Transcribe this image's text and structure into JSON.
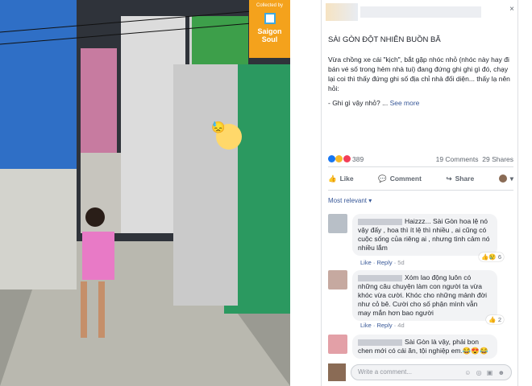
{
  "photo": {
    "badge_top": "Collected by",
    "badge_brand_1": "Saigon",
    "badge_brand_2": "Soul",
    "sweat_emoji": "😓"
  },
  "post": {
    "close_glyph": "×",
    "title": "SÀI GÒN ĐỘT NHIÊN BUỒN BÃ",
    "body_1": "Vừa chồng xe cái \"kịch\", bắt gặp nhóc nhỏ (nhóc này hay đi bán vé số trong hẻm nhà tui) đang đứng ghi ghi gì đó, chạy lại coi thì thấy đứng ghi số địa chỉ nhà đối diện... thấy lạ nên hỏi:",
    "body_2": "- Ghi gì vậy nhỏ? ...",
    "see_more": "See more",
    "reaction_count": "389",
    "comments_count": "19 Comments",
    "shares_count": "29 Shares",
    "actions": {
      "like": "Like",
      "comment": "Comment",
      "share": "Share"
    },
    "most_relevant": "Most relevant ▾",
    "reaction_colors": [
      "#1877f2",
      "#f7b928",
      "#f33e58"
    ]
  },
  "comments": [
    {
      "text": "Haizzz... Sài Gòn hoa lệ nó vậy đấy , hoa thì ít lệ thì nhiều , ai cũng có cuộc sống của riêng ai , nhưng tình cảm nó nhiều lắm",
      "like": "Like",
      "reply": "Reply",
      "time": "5d",
      "reactions": "👍😢 6"
    },
    {
      "text": "Xóm lao động luôn có những câu chuyện làm con người ta vừa khóc vừa cười. Khóc cho những mảnh đời như cỏ bê. Cười cho số phận mình vẫn may mắn hơn bao người",
      "like": "Like",
      "reply": "Reply",
      "time": "4d",
      "reactions": "👍 2"
    },
    {
      "text": "Sài Gòn là vậy, phải bon chen mới có cái ăn, tội nghiệp em.😂😍😂",
      "like": "",
      "reply": "",
      "time": "",
      "reactions": ""
    }
  ],
  "write_comment": {
    "placeholder": "Write a comment...",
    "tools": "☺ ◎ ▣ ☻"
  }
}
